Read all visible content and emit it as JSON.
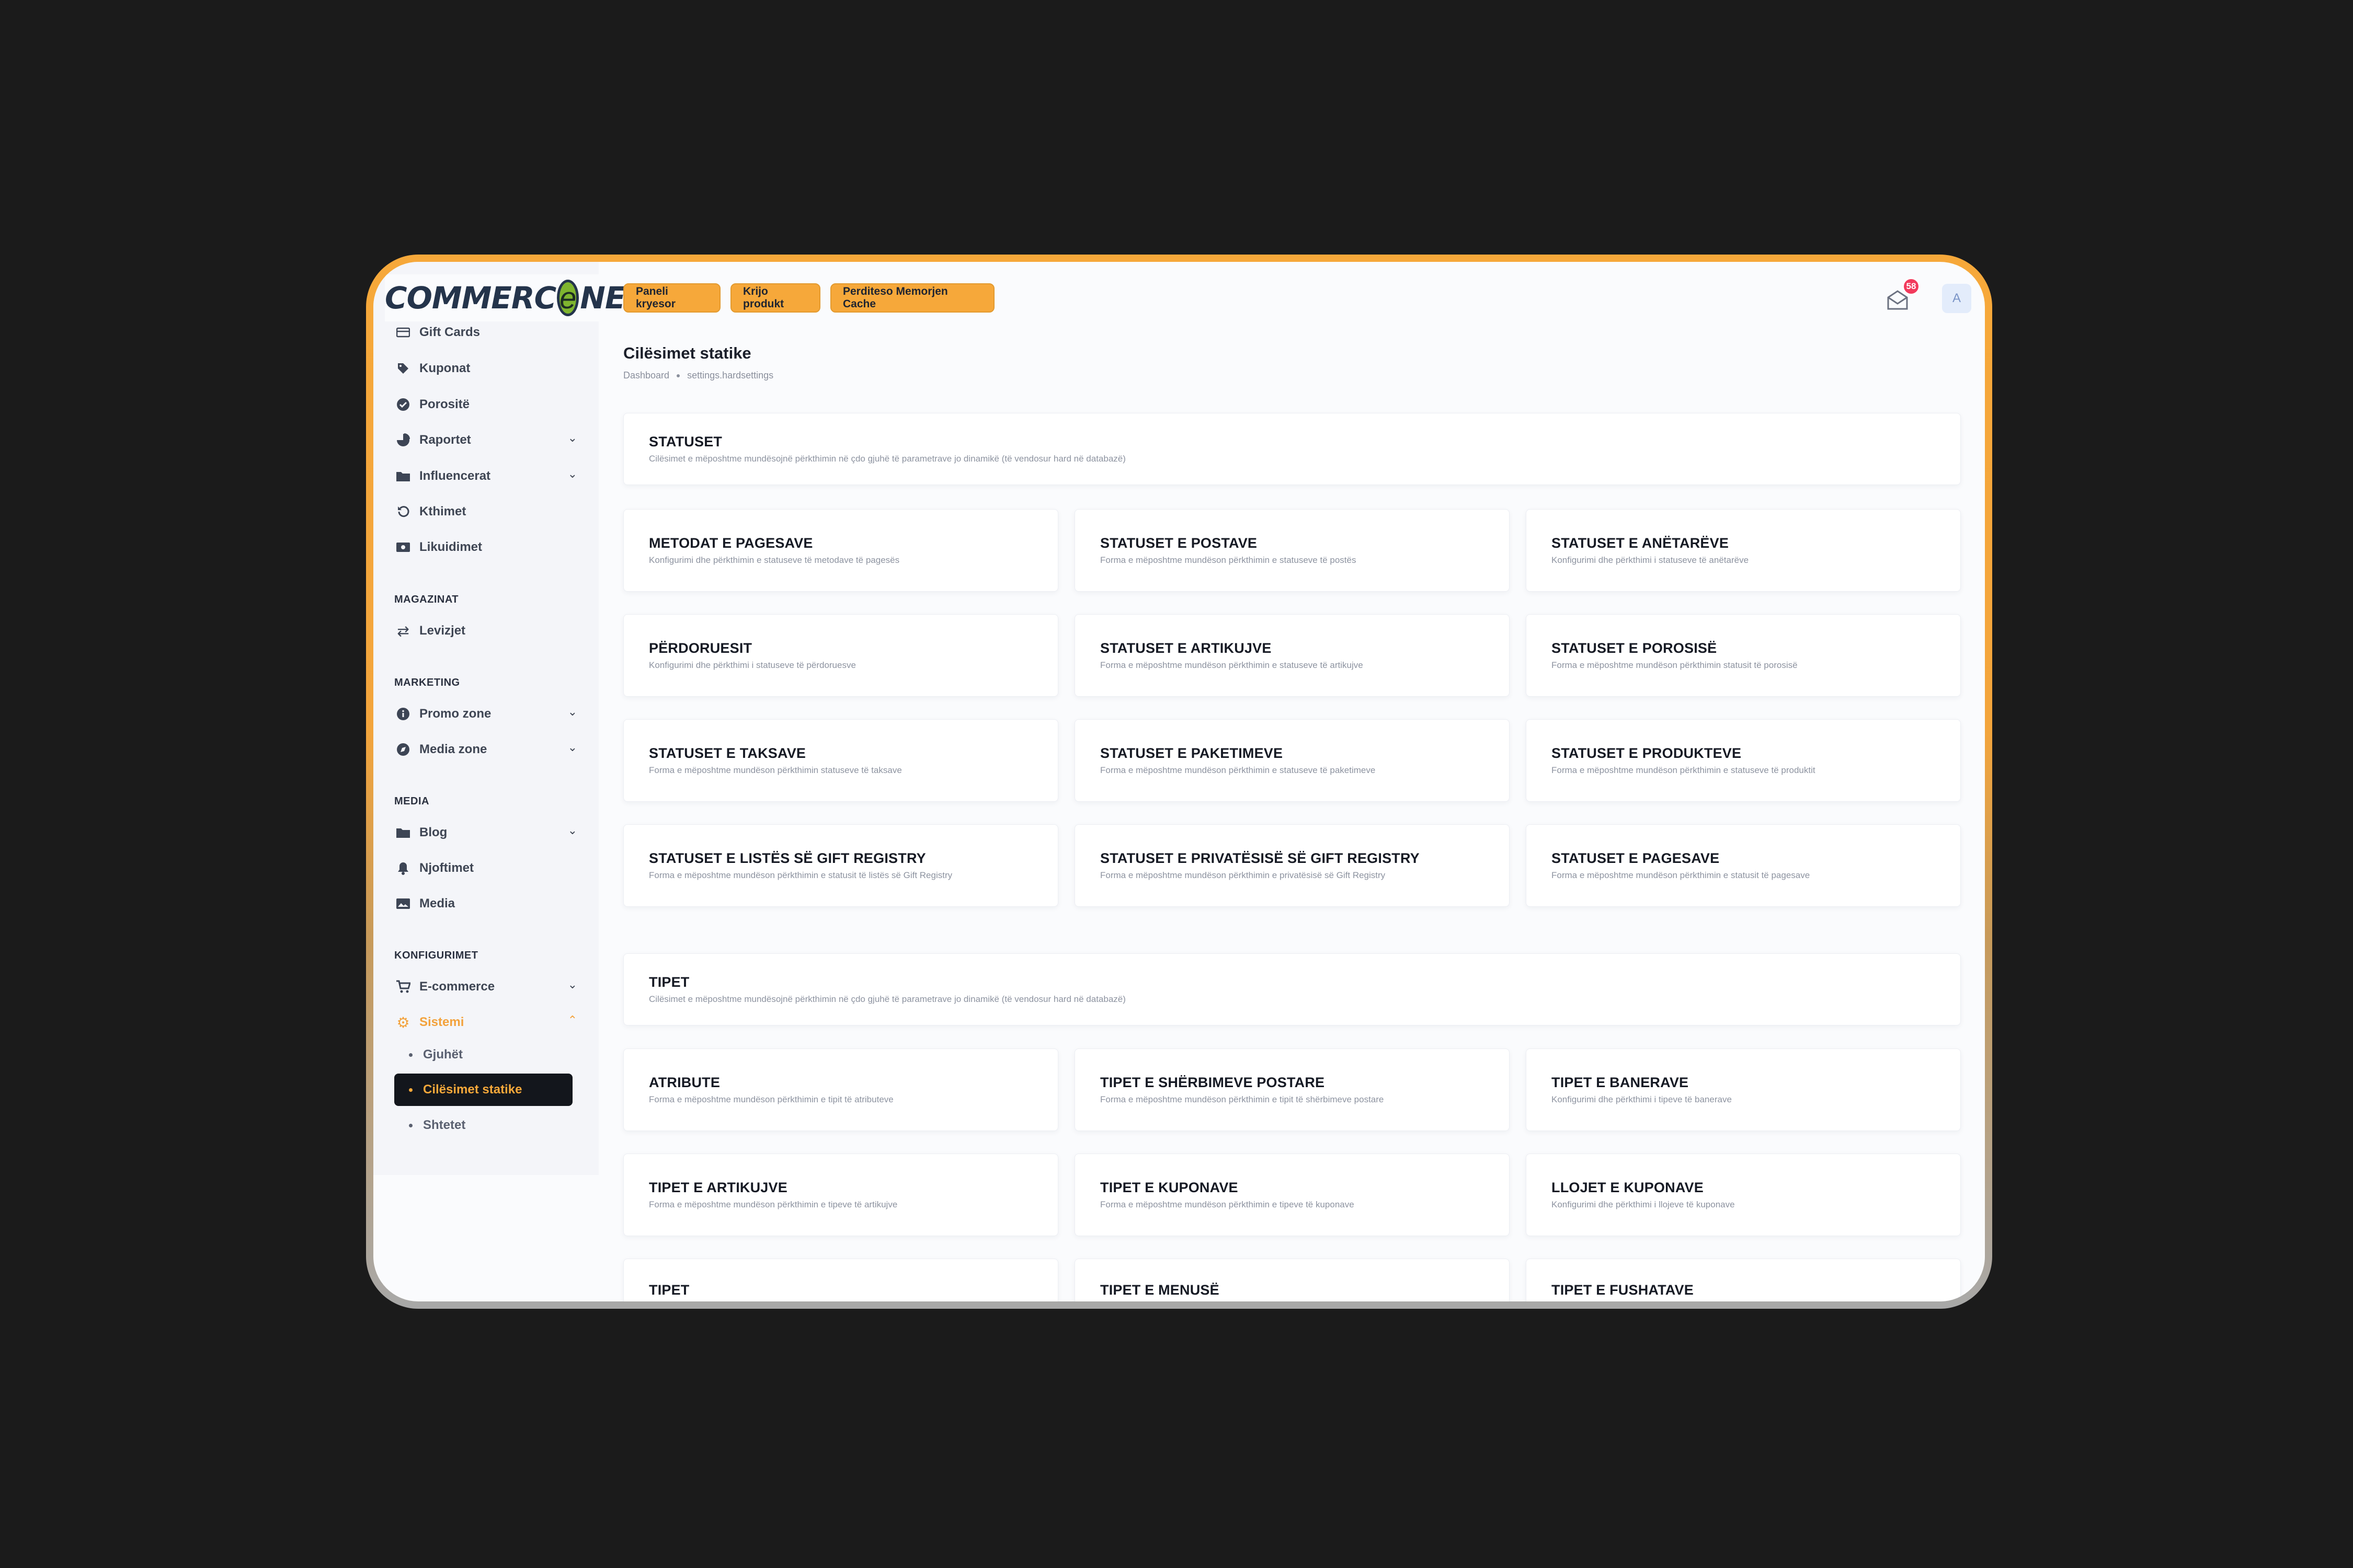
{
  "brand": {
    "logo_left": "COMMERC",
    "logo_e": "e",
    "logo_right": "NE"
  },
  "topbar": {
    "buttons": [
      "Paneli kryesor",
      "Krijo produkt",
      "Perditeso Memorjen Cache"
    ],
    "notification_count": "58",
    "avatar_initial": "A"
  },
  "sidebar": {
    "items": [
      {
        "label": "Gift Cards",
        "icon": "card-icon"
      },
      {
        "label": "Kuponat",
        "icon": "tag-icon"
      },
      {
        "label": "Porositë",
        "icon": "check-circle-icon"
      },
      {
        "label": "Raportet",
        "icon": "pie-chart-icon",
        "chevron": true
      },
      {
        "label": "Influencerat",
        "icon": "folder-icon",
        "chevron": true
      },
      {
        "label": "Kthimet",
        "icon": "undo-icon"
      },
      {
        "label": "Likuidimet",
        "icon": "money-icon"
      }
    ],
    "sections": {
      "magazinat": {
        "title": "MAGAZINAT",
        "items": [
          {
            "label": "Levizjet",
            "icon": "exchange-icon"
          }
        ]
      },
      "marketing": {
        "title": "MARKETING",
        "items": [
          {
            "label": "Promo zone",
            "icon": "info-icon",
            "chevron": true
          },
          {
            "label": "Media zone",
            "icon": "compass-icon",
            "chevron": true
          }
        ]
      },
      "media": {
        "title": "MEDIA",
        "items": [
          {
            "label": "Blog",
            "icon": "folder-icon",
            "chevron": true
          },
          {
            "label": "Njoftimet",
            "icon": "bell-icon"
          },
          {
            "label": "Media",
            "icon": "images-icon"
          }
        ]
      },
      "konfigurimet": {
        "title": "KONFIGURIMET",
        "items": [
          {
            "label": "E-commerce",
            "icon": "cart-icon",
            "chevron": true
          },
          {
            "label": "Sistemi",
            "icon": "gear-icon",
            "chevron": true,
            "active": true
          }
        ]
      }
    },
    "subitems": [
      {
        "label": "Gjuhët",
        "active": false
      },
      {
        "label": "Cilësimet statike",
        "active": true
      },
      {
        "label": "Shtetet",
        "active": false
      }
    ]
  },
  "page": {
    "title": "Cilësimet statike",
    "breadcrumb": [
      "Dashboard",
      "settings.hardsettings"
    ]
  },
  "statuset": {
    "title": "STATUSET",
    "desc": "Cilësimet e mëposhtme mundësojnë përkthimin në çdo gjuhë të parametrave jo dinamikë (të vendosur hard në databazë)",
    "cards": [
      {
        "title": "METODAT E PAGESAVE",
        "desc": "Konfigurimi dhe përkthimin e statuseve të metodave të pagesës"
      },
      {
        "title": "STATUSET E POSTAVE",
        "desc": "Forma e mëposhtme mundëson përkthimin e statuseve të postës"
      },
      {
        "title": "STATUSET E ANËTARËVE",
        "desc": "Konfigurimi dhe përkthimi i statuseve të anëtarëve"
      },
      {
        "title": "PËRDORUESIT",
        "desc": "Konfigurimi dhe përkthimi i statuseve të përdoruesve"
      },
      {
        "title": "STATUSET E ARTIKUJVE",
        "desc": "Forma e mëposhtme mundëson përkthimin e statuseve të artikujve"
      },
      {
        "title": "STATUSET E POROSISË",
        "desc": "Forma e mëposhtme mundëson përkthimin statusit të porosisë"
      },
      {
        "title": "STATUSET E TAKSAVE",
        "desc": "Forma e mëposhtme mundëson përkthimin statuseve të taksave"
      },
      {
        "title": "STATUSET E PAKETIMEVE",
        "desc": "Forma e mëposhtme mundëson përkthimin e statuseve të paketimeve"
      },
      {
        "title": "STATUSET E PRODUKTEVE",
        "desc": "Forma e mëposhtme mundëson përkthimin e statuseve të produktit"
      },
      {
        "title": "STATUSET E LISTËS SË GIFT REGISTRY",
        "desc": "Forma e mëposhtme mundëson përkthimin e statusit të listës së Gift Registry"
      },
      {
        "title": "STATUSET E PRIVATËSISË SË GIFT REGISTRY",
        "desc": "Forma e mëposhtme mundëson përkthimin e privatësisë së Gift Registry"
      },
      {
        "title": "STATUSET E PAGESAVE",
        "desc": "Forma e mëposhtme mundëson përkthimin e statusit të pagesave"
      }
    ]
  },
  "tipet": {
    "title": "TIPET",
    "desc": "Cilësimet e mëposhtme mundësojnë përkthimin në çdo gjuhë të parametrave jo dinamikë (të vendosur hard në databazë)",
    "cards": [
      {
        "title": "ATRIBUTE",
        "desc": "Forma e mëposhtme mundëson përkthimin e tipit të atributeve"
      },
      {
        "title": "TIPET E SHËRBIMEVE POSTARE",
        "desc": "Forma e mëposhtme mundëson përkthimin e tipit të shërbimeve postare"
      },
      {
        "title": "TIPET E BANERAVE",
        "desc": "Konfigurimi dhe përkthimi i tipeve të banerave"
      },
      {
        "title": "TIPET E ARTIKUJVE",
        "desc": "Forma e mëposhtme mundëson përkthimin e tipeve të artikujve"
      },
      {
        "title": "TIPET E KUPONAVE",
        "desc": "Forma e mëposhtme mundëson përkthimin e tipeve të kuponave"
      },
      {
        "title": "LLOJET E KUPONAVE",
        "desc": "Konfigurimi dhe përkthimi i llojeve të kuponave"
      },
      {
        "title": "TIPET",
        "desc": ""
      },
      {
        "title": "TIPET E MENUSË",
        "desc": ""
      },
      {
        "title": "TIPET E FUSHATAVE",
        "desc": ""
      }
    ]
  }
}
